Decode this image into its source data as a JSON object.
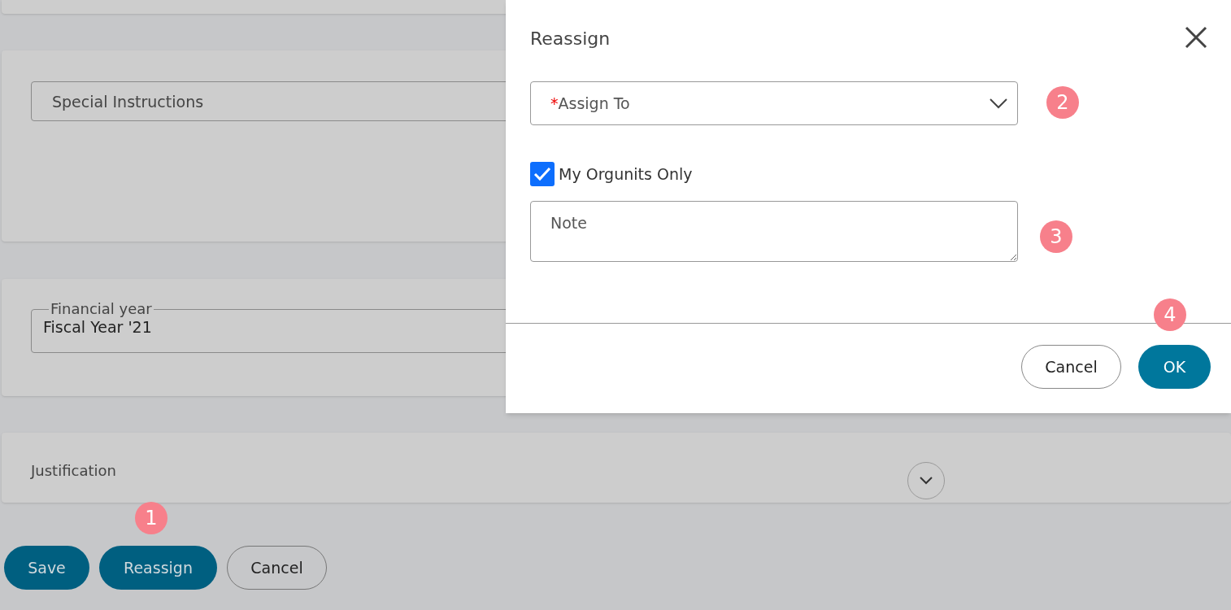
{
  "form": {
    "special_instructions": {
      "placeholder": "Special Instructions"
    },
    "financial_year": {
      "label": "Financial year",
      "value": "Fiscal Year '21"
    },
    "justification": {
      "label": "Justification",
      "expanded": false
    }
  },
  "actions": [
    "Save",
    "Reassign",
    "Cancel"
  ],
  "dialog": {
    "title": "Reassign",
    "assign_to": {
      "required_mark": "*",
      "placeholder": "Assign To"
    },
    "my_orgunits_only": {
      "label": "My Orgunits Only",
      "checked": true
    },
    "note": {
      "placeholder": "Note"
    },
    "buttons": [
      {
        "label": "Cancel",
        "kind": "secondary"
      },
      {
        "label": "OK",
        "kind": "primary"
      }
    ]
  },
  "step_markers": [
    {
      "label": "1"
    },
    {
      "label": "2"
    },
    {
      "label": "3"
    },
    {
      "label": "4"
    }
  ]
}
